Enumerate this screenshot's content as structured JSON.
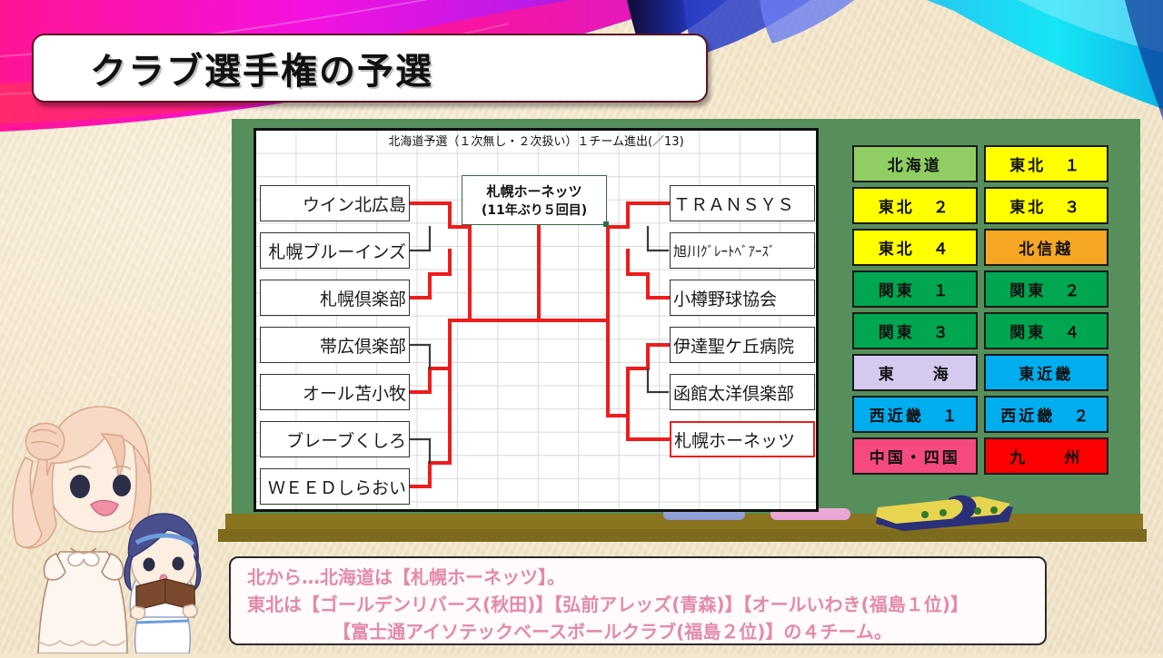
{
  "page": {
    "title": "クラブ選手権の予選"
  },
  "bracket": {
    "header": "北海道予選（１次無し・２次扱い）１チーム進出(／13)",
    "champion": {
      "name": "札幌ホーネッツ",
      "note": "(11年ぶり５回目)"
    },
    "left_teams": [
      "ウイン北広島",
      "札幌ブルーインズ",
      "札幌倶楽部",
      "帯広倶楽部",
      "オール苫小牧",
      "ブレーブくしろ",
      "ＷＥＥＤしらおい"
    ],
    "right_teams": [
      "ＴＲＡＮＳＹＳ",
      "旭川ｸﾞﾚｰﾄﾍﾞｱｰｽﾞ",
      "小樽野球協会",
      "伊達聖ケ丘病院",
      "函館太洋倶楽部",
      "札幌ホーネッツ"
    ],
    "winner_team": "札幌ホーネッツ",
    "win_line_color": "#ee1c1c",
    "lose_line_color": "#3a3a3a"
  },
  "regions": [
    {
      "label": "北海道",
      "bg": "#8ece63",
      "selected": true
    },
    {
      "label": "東北　１",
      "bg": "#ffff00",
      "selected": false
    },
    {
      "label": "東北　２",
      "bg": "#ffff00",
      "selected": false
    },
    {
      "label": "東北　３",
      "bg": "#ffff00",
      "selected": false
    },
    {
      "label": "東北　４",
      "bg": "#ffff00",
      "selected": false
    },
    {
      "label": "北信越",
      "bg": "#f5a623",
      "selected": false
    },
    {
      "label": "関東　１",
      "bg": "#00a650",
      "selected": false
    },
    {
      "label": "関東　２",
      "bg": "#00a650",
      "selected": false
    },
    {
      "label": "関東　３",
      "bg": "#00a650",
      "selected": false
    },
    {
      "label": "関東　４",
      "bg": "#00a650",
      "selected": false
    },
    {
      "label": "東　　海",
      "bg": "#d6c9f0",
      "selected": false
    },
    {
      "label": "東近畿",
      "bg": "#00aeef",
      "selected": false
    },
    {
      "label": "西近畿　１",
      "bg": "#00aeef",
      "selected": false
    },
    {
      "label": "西近畿　２",
      "bg": "#00aeef",
      "selected": false
    },
    {
      "label": "中国・四国",
      "bg": "#f5497f",
      "selected": false
    },
    {
      "label": "九　　州",
      "bg": "#ff0000",
      "selected": false
    }
  ],
  "caption": {
    "line1": "北から…北海道は【札幌ホーネッツ】。",
    "line2": "東北は【ゴールデンリバース(秋田)】【弘前アレッズ(青森)】【オールいわき(福島１位)】",
    "line3": "【富士通アイソテックベースボールクラブ(福島２位)】の４チーム。"
  },
  "board": {
    "chalk_blue_color": "#9aa8dd",
    "chalk_pink_color": "#eeaad6",
    "eraser_body_color": "#e8d44f",
    "eraser_base_color": "#2a2f7a"
  },
  "theme": {
    "board_green": "#568f5b",
    "shelf_brown": "#8a7420",
    "title_plate_border": "#5a1422",
    "caption_text": "#e38aa9"
  }
}
